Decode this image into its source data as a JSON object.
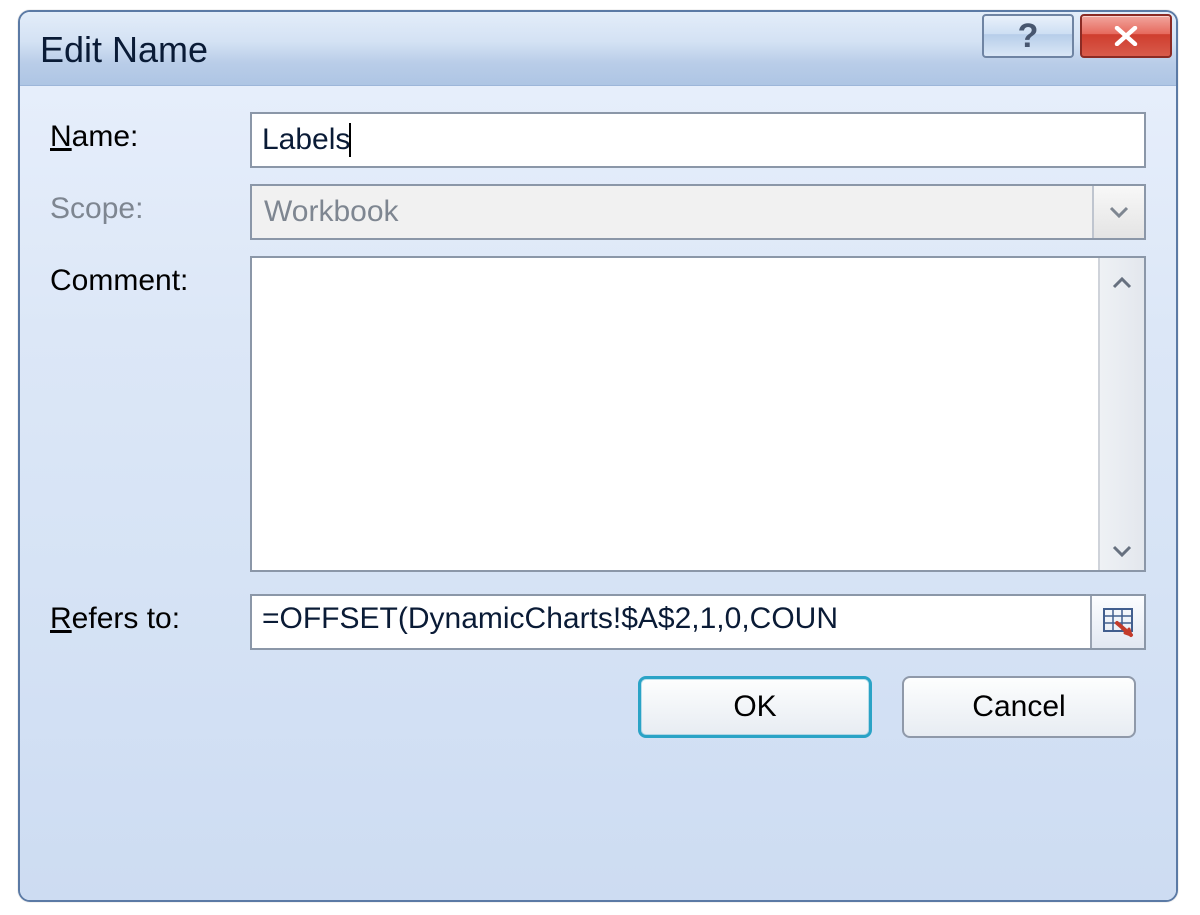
{
  "title": "Edit Name",
  "labels": {
    "name": "ame:",
    "name_prefix": "N",
    "scope": "Scope:",
    "comment": "Comment:",
    "comment_prefix": "C",
    "refers_prefix": "R",
    "refers": "efers to:"
  },
  "fields": {
    "name_value": "Labels",
    "scope_value": "Workbook",
    "comment_value": "",
    "refers_value": "=OFFSET(DynamicCharts!$A$2,1,0,COUN"
  },
  "buttons": {
    "ok": "OK",
    "cancel": "Cancel"
  }
}
